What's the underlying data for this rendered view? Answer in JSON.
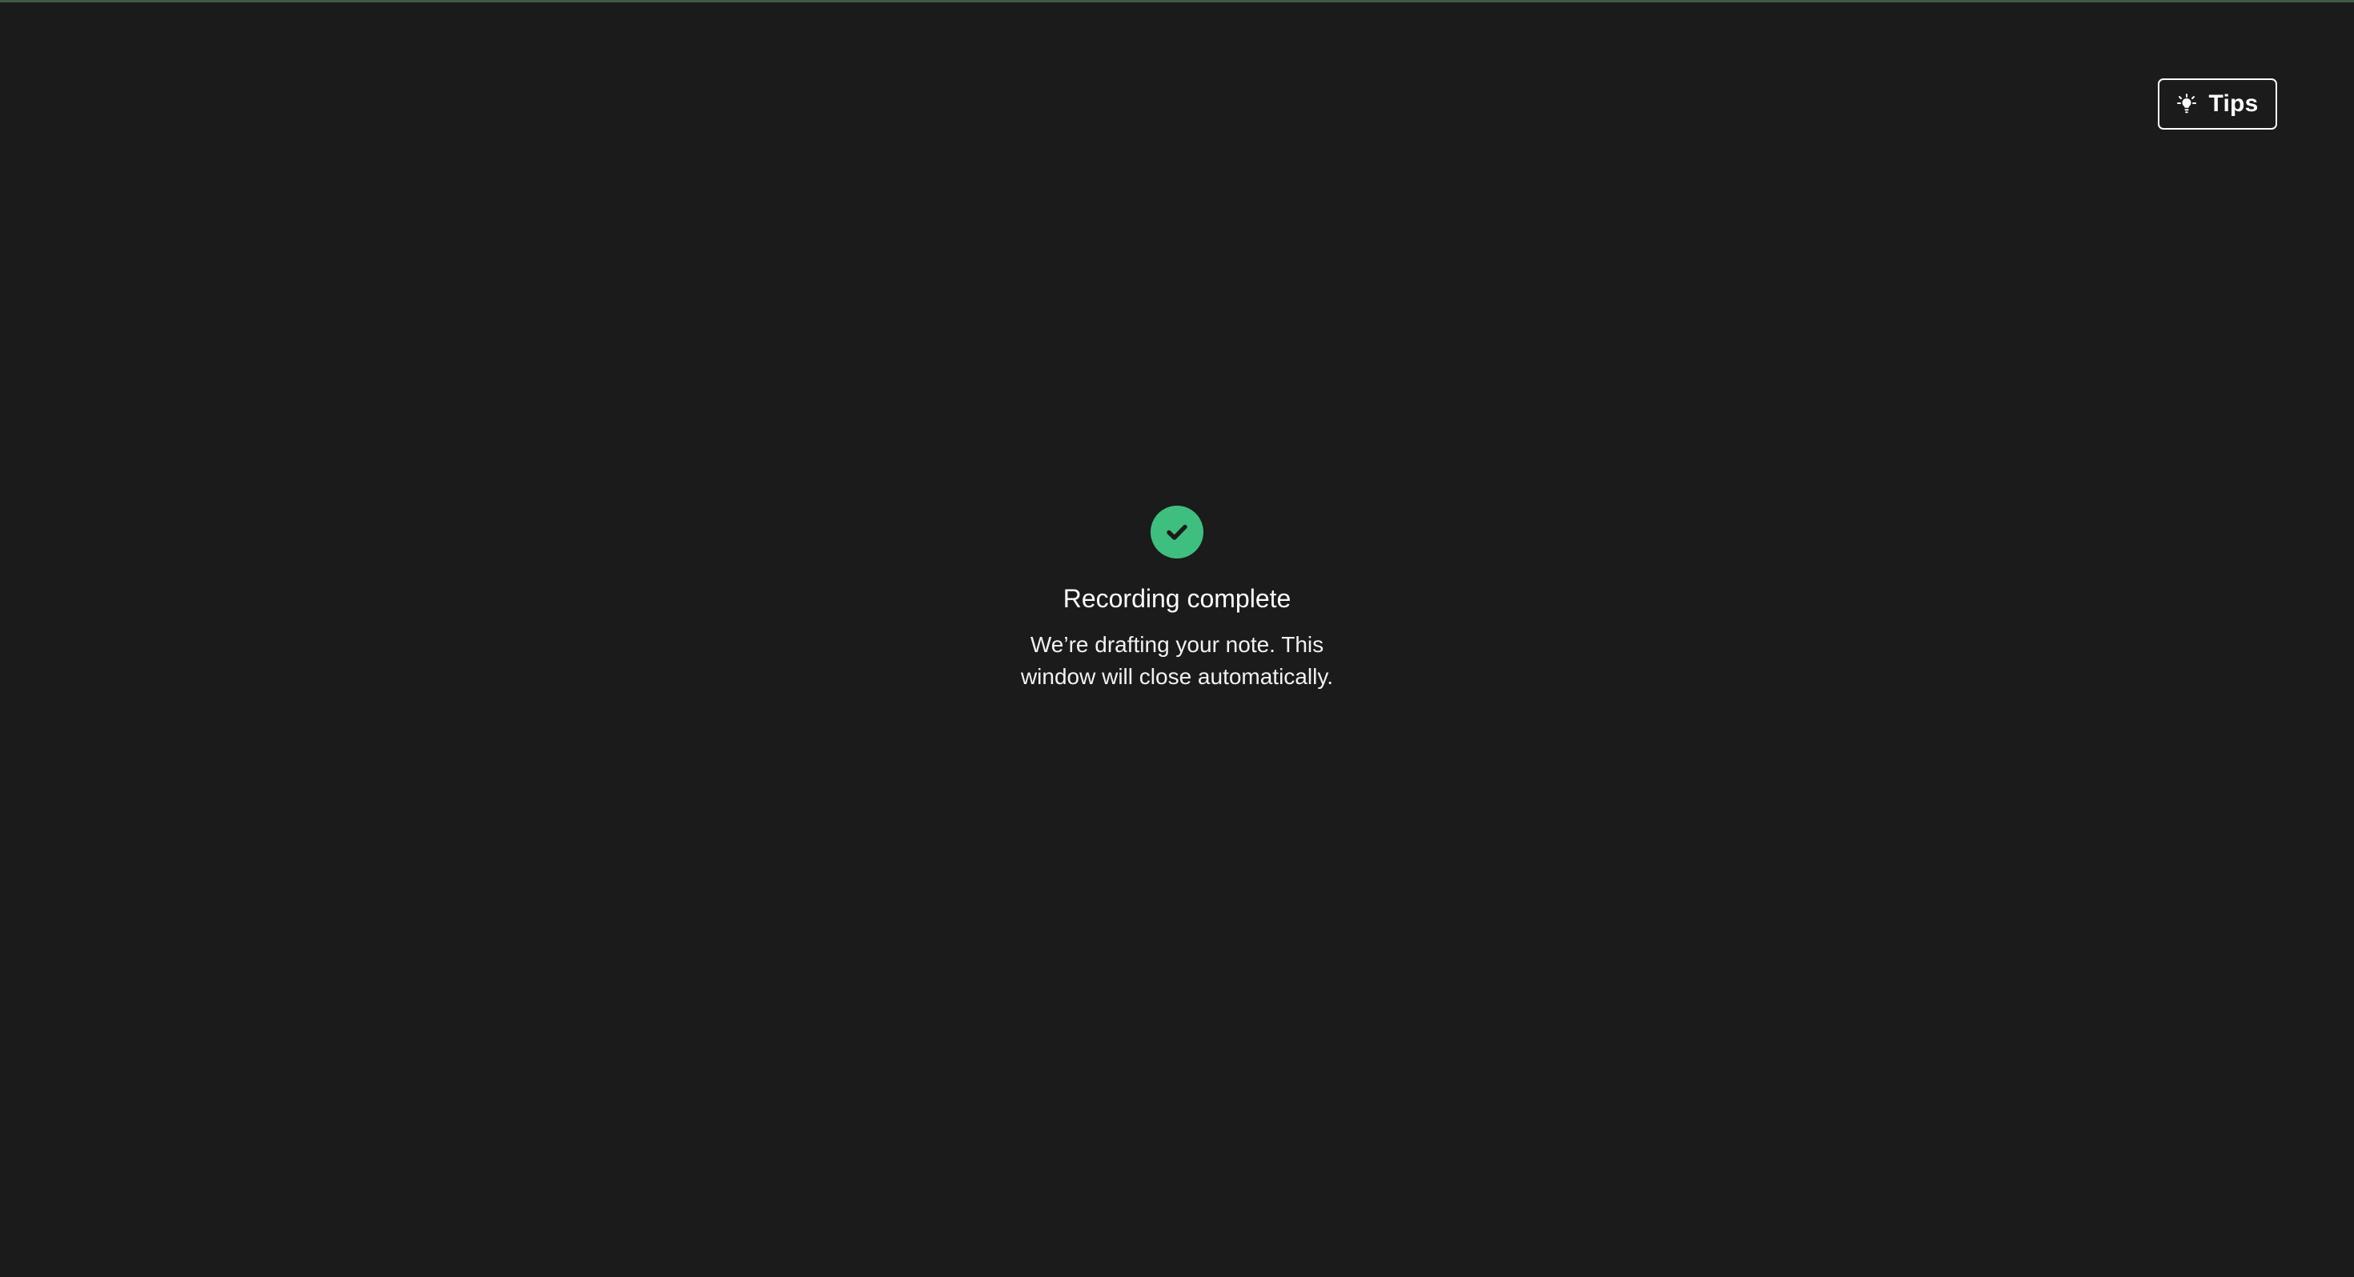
{
  "header": {
    "tips_button": {
      "label": "Tips",
      "icon": "lightbulb-icon"
    }
  },
  "status": {
    "icon": "check-circle-icon",
    "title": "Recording complete",
    "message": "We’re drafting your note. This window will close automatically."
  },
  "colors": {
    "background": "#1b1b1b",
    "success": "#3fbf7f",
    "top_accent": "#3f5a43",
    "text": "#ffffff"
  }
}
